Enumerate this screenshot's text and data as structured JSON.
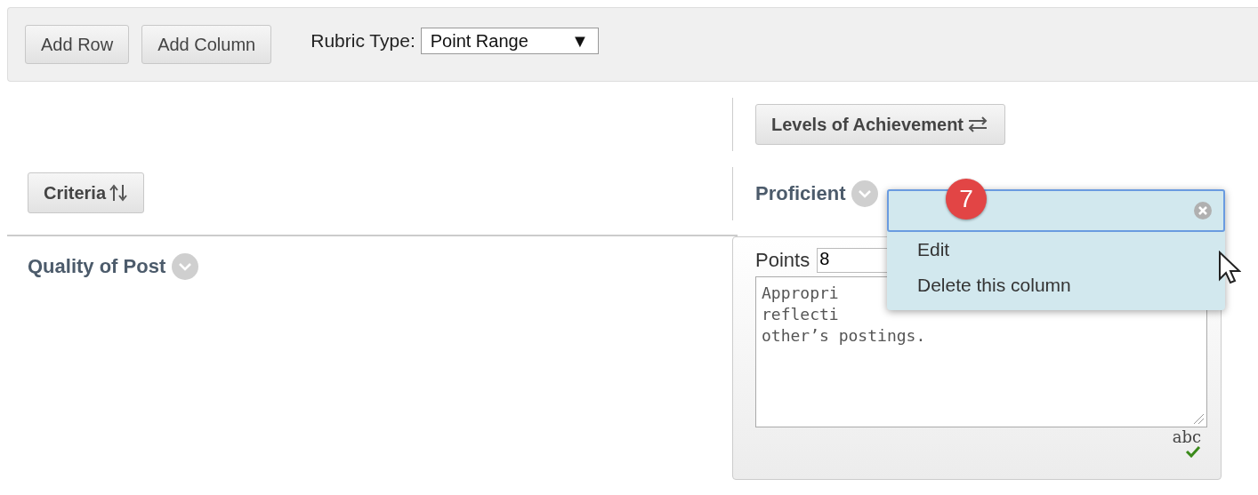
{
  "toolbar": {
    "buttons": [
      "Add Row",
      "Add Column"
    ],
    "rubric_type": {
      "label": "Rubric Type:",
      "value": "Point Range",
      "arrow": "▼"
    }
  },
  "levels_button": "Levels of Achievement",
  "criteria_button": "Criteria",
  "column": {
    "title": "Proficient",
    "points_label": "Points",
    "points_value": "8",
    "description_lines": [
      "Appropri",
      "reflecti",
      "other’s postings."
    ],
    "spellcheck": "abc"
  },
  "row": {
    "title": "Quality of Post"
  },
  "menu": {
    "badge": "7",
    "items": [
      "Edit",
      "Delete this column"
    ]
  }
}
